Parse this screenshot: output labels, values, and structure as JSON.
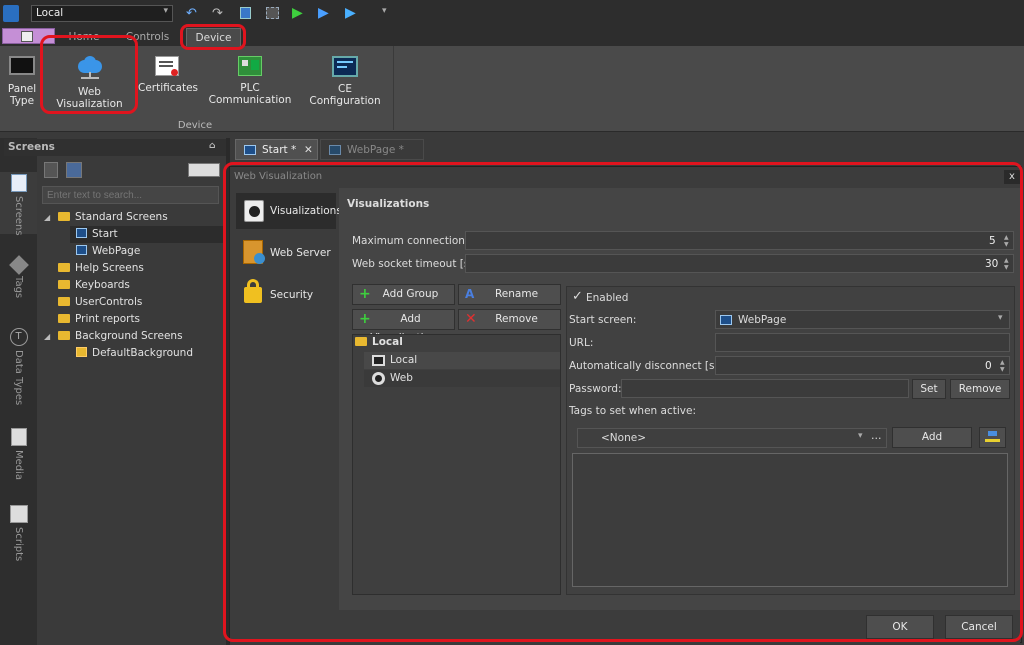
{
  "toolbar": {
    "combo_value": "Local"
  },
  "ribbon": {
    "tabs": [
      "Home",
      "Controls",
      "Device"
    ],
    "buttons": [
      "Panel\nType",
      "Web Visualization",
      "Certificates",
      "PLC Communication",
      "CE Configuration"
    ],
    "panel_type_l1": "Panel",
    "panel_type_l2": "Type",
    "group": "Device"
  },
  "screens_panel": {
    "title": "Screens",
    "pin": "⌂",
    "search_placeholder": "Enter text to search...",
    "tree": {
      "standard": "Standard Screens",
      "start": "Start",
      "webpage": "WebPage",
      "help": "Help Screens",
      "keyboards": "Keyboards",
      "usercontrols": "UserControls",
      "print": "Print reports",
      "background": "Background Screens",
      "defaultbg": "DefaultBackground"
    }
  },
  "side_tabs": [
    "Screens",
    "Tags",
    "Data Types",
    "Media",
    "Scripts"
  ],
  "doc_tabs": {
    "start": "Start *",
    "webpage": "WebPage *"
  },
  "dialog": {
    "title": "Web Visualization",
    "close": "x",
    "nav": [
      "Visualizations",
      "Web Server",
      "Security"
    ],
    "section_title": "Visualizations",
    "max_conn_label": "Maximum connections:",
    "max_conn_value": "5",
    "ws_timeout_label": "Web socket timeout [s]:",
    "ws_timeout_value": "30",
    "buttons": {
      "add_group": "Add Group",
      "rename": "Rename",
      "add_vis": "Add Visualization",
      "remove": "Remove"
    },
    "list": {
      "group": "Local",
      "item1": "Local",
      "item2": "Web"
    },
    "enabled_label": "Enabled",
    "start_screen_label": "Start screen:",
    "start_screen_value": "WebPage",
    "url_label": "URL:",
    "url_value": "",
    "auto_disc_label": "Automatically disconnect [sec]:",
    "auto_disc_value": "0",
    "password_label": "Password:",
    "set_label": "Set",
    "remove_label": "Remove",
    "tags_label": "Tags to set when active:",
    "tags_combo": "<None>",
    "ellipsis": "…",
    "add_label": "Add",
    "ok": "OK",
    "cancel": "Cancel"
  },
  "colors": {
    "highlight": "#e0141e",
    "accent_blue": "#2f8fe0"
  }
}
